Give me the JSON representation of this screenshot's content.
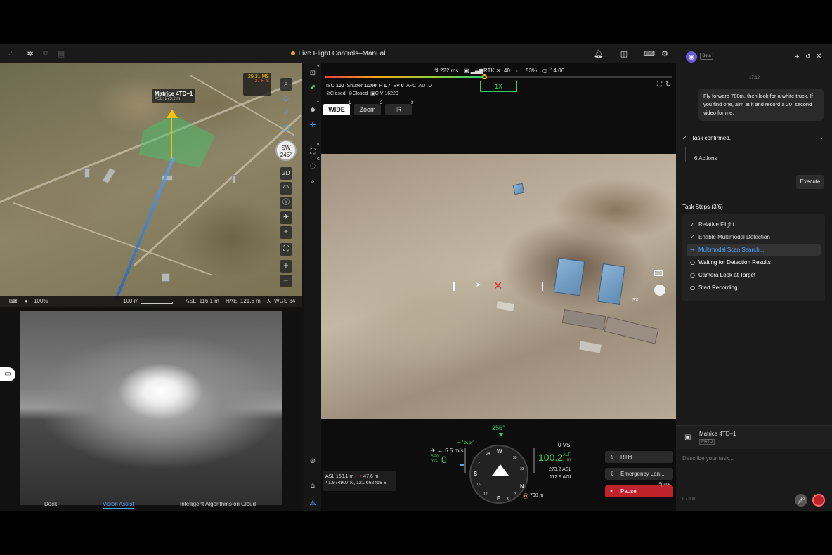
{
  "header": {
    "title": "Live Flight Controls–Manual"
  },
  "map": {
    "aircraft_label": "Matrice 4TD–1",
    "aircraft_asl": "ASL: 273.2 m",
    "speed_badge": "29.31 MS",
    "fps_badge": "27 FPS",
    "compass_dir": "SW",
    "compass_deg": "245°",
    "view_2d": "2D",
    "opacity": "100%",
    "scale": "100 m",
    "asl": "ASL: 116.1 m",
    "hae": "HAE: 121.6 m",
    "datum": "WGS 84"
  },
  "bottom_tabs": {
    "dock": "Dock",
    "vision": "Vision Assist",
    "algos": "Intelligent Algorithms on Cloud"
  },
  "status": {
    "latency": "222 ms",
    "rtk": "RTK",
    "satellites": "40",
    "battery": "53%",
    "time": "14:06",
    "flight_progress": 0.46
  },
  "exposure": {
    "iso": "ISO",
    "iso_val": "100",
    "shutter": "Shutter",
    "shutter_val": "1/200",
    "f": "F",
    "f_val": "1.7",
    "ev": "EV",
    "ev_val": "0",
    "afc": "AFC",
    "auto": "AUTO",
    "closed1": "Closed",
    "closed2": "Closed",
    "civ": "CIV 16220"
  },
  "zoom_box": "1X",
  "lenses": {
    "wide": "WIDE",
    "wide_n": "1",
    "zoom": "Zoom",
    "zoom_n": "2",
    "ir": "IR",
    "ir_n": "3"
  },
  "feed_overlay": {
    "zoom_3x": "3X"
  },
  "hud": {
    "heading": "256°",
    "gimbal": "–75.5°",
    "hspeed": "← 5.5 m/s",
    "spd": "SPD",
    "ms": "m/s",
    "spd_val": "0",
    "vs": "0 VS",
    "alt": "100.2",
    "alt_unit": "ALT",
    "m": "m",
    "asl_val": "273.2 ASL",
    "agl_val": "112.9 AGL",
    "dist": "700 m",
    "pos_asl": "ASL 163.1 m",
    "pos_dist": "47.6 m",
    "coords": "41.974907 N, 121.662468 E",
    "compass_w": "W",
    "compass_s": "S",
    "compass_n": "N",
    "compass_e": "E",
    "compass_21": "21",
    "compass_24": "24",
    "compass_30": "30",
    "compass_33": "33",
    "compass_3": "3",
    "compass_6": "6",
    "compass_12": "12",
    "compass_15": "15"
  },
  "controls": {
    "rth": "RTH",
    "emergency": "Emergency Lan...",
    "pause": "Pause",
    "space": "Space"
  },
  "side_letters": {
    "v": "V",
    "t": "T",
    "b": "B",
    "g": "G"
  },
  "assistant": {
    "beta": "Beta",
    "time": "17:12",
    "user_msg": "Fly forward 700m, then look for a white truck. If you find one, aim at it and record a 20–second video for me.",
    "task_confirmed": "Task confirmed.",
    "actions": "6 Actions",
    "execute": "Execute",
    "steps_title": "Task Steps (3/6)",
    "steps": [
      {
        "label": "Relative Flight",
        "state": "done"
      },
      {
        "label": "Enable Multimodal Detection",
        "state": "done"
      },
      {
        "label": "Multimodal Scan Search...",
        "state": "active"
      },
      {
        "label": "Waiting for Detection Results",
        "state": "pending"
      },
      {
        "label": "Camera Look at Target",
        "state": "pending"
      },
      {
        "label": "Start Recording",
        "state": "pending"
      }
    ],
    "device": "Matrice 4TD–1",
    "device_tag": "M4TD",
    "input_placeholder": "Describe your task...",
    "char_count": "0 / 800"
  },
  "colors": {
    "accent": "#3b82f6",
    "green": "#2ecc71",
    "pause_red": "#c0222c",
    "badge_orange": "#f5a623"
  }
}
